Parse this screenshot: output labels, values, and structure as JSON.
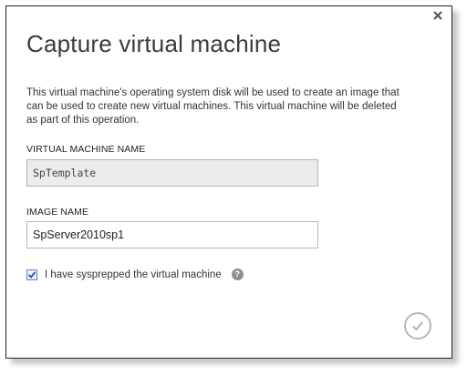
{
  "dialog": {
    "title": "Capture virtual machine",
    "description": "This virtual machine's operating system disk will be used to create an image that can be used to create new virtual machines. This virtual machine will be deleted as part of this operation.",
    "vm_name_label": "VIRTUAL MACHINE NAME",
    "vm_name_value": "SpTemplate",
    "image_name_label": "IMAGE NAME",
    "image_name_value": "SpServer2010sp1",
    "sysprep_checked": true,
    "sysprep_label": "I have sysprepped the virtual machine",
    "help_glyph": "?"
  },
  "icons": {
    "close": "close-icon",
    "help": "help-icon",
    "confirm": "checkmark-icon",
    "checkbox": "checkbox-checked-icon"
  },
  "colors": {
    "title": "#3b3b3b",
    "checkbox_mark": "#2a4fa0",
    "confirm_ring": "#b8b8b8"
  }
}
